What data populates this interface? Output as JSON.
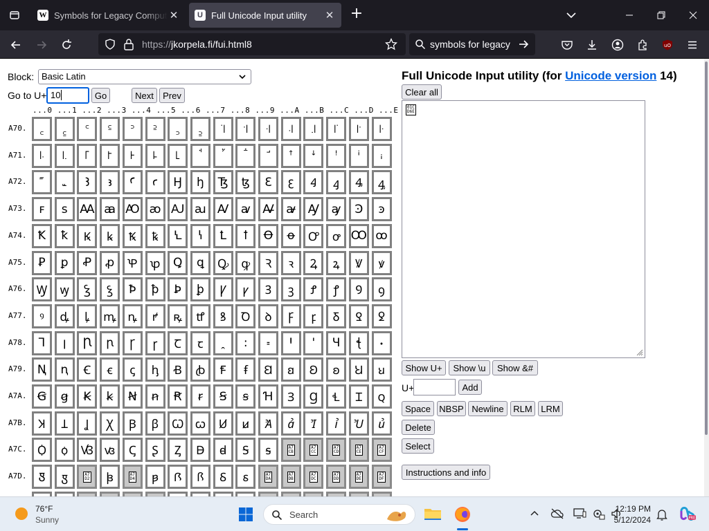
{
  "browser": {
    "tabs": [
      {
        "title": "Symbols for Legacy Computing",
        "favicon": "W",
        "active": false
      },
      {
        "title": "Full Unicode Input utility",
        "favicon": "U",
        "active": true
      }
    ],
    "url_scheme": "https://",
    "url_rest": "jkorpela.fi/fui.html8",
    "search_text": "symbols for legacy c"
  },
  "page": {
    "block_label": "Block:",
    "block_value": "Basic Latin",
    "goto_label": "Go to U+",
    "goto_value": "10",
    "go_label": "Go",
    "next_label": "Next",
    "prev_label": "Prev",
    "column_headers": "...0 ...1 ...2 ...3 ...4 ...5 ...6 ...7 ...8 ...9 ...A ...B ...C ...D ...E ...F",
    "heading_prefix": "Full Unicode Input utility (for ",
    "heading_link": "Unicode version",
    "heading_suffix": " 14)",
    "clear_all_label": "Clear all",
    "textarea_char": "01C\nD6E",
    "show_uplus_label": "Show U+",
    "show_u_label": "Show \\u",
    "show_amp_label": "Show &#",
    "uplus_label": "U+",
    "add_label": "Add",
    "space_label": "Space",
    "nbsp_label": "NBSP",
    "newline_label": "Newline",
    "rlm_label": "RLM",
    "lrm_label": "LRM",
    "delete_label": "Delete",
    "select_label": "Select",
    "instructions_label": "Instructions and info"
  },
  "grid": [
    {
      "label": "A70.",
      "cells": [
        "꜀",
        "꜁",
        "꜂",
        "꜃",
        "꜄",
        "꜅",
        "꜆",
        "꜇",
        "꜈",
        "꜉",
        "꜊",
        "꜋",
        "꜌",
        "꜍",
        "꜎",
        "꜏"
      ]
    },
    {
      "label": "A71.",
      "cells": [
        "꜐",
        "꜑",
        "꜒",
        "꜓",
        "꜔",
        "꜕",
        "꜖",
        "ꜗ",
        "ꜘ",
        "ꜙ",
        "ꜚ",
        "ꜛ",
        "ꜜ",
        "ꜝ",
        "ꜞ",
        "ꜟ"
      ]
    },
    {
      "label": "A72.",
      "cells": [
        "꜠",
        "꜡",
        "Ꜣ",
        "ꜣ",
        "Ꜥ",
        "ꜥ",
        "Ꜧ",
        "ꜧ",
        "Ꜩ",
        "ꜩ",
        "Ꜫ",
        "ꜫ",
        "Ꜭ",
        "ꜭ",
        "Ꜯ",
        "ꜯ"
      ]
    },
    {
      "label": "A73.",
      "cells": [
        "ꜰ",
        "ꜱ",
        "Ꜳ",
        "ꜳ",
        "Ꜵ",
        "ꜵ",
        "Ꜷ",
        "ꜷ",
        "Ꜹ",
        "ꜹ",
        "Ꜻ",
        "ꜻ",
        "Ꜽ",
        "ꜽ",
        "Ꜿ",
        "ꜿ"
      ]
    },
    {
      "label": "A74.",
      "cells": [
        "Ꝁ",
        "ꝁ",
        "Ꝃ",
        "ꝃ",
        "Ꝅ",
        "ꝅ",
        "Ꝇ",
        "ꝇ",
        "Ꝉ",
        "ꝉ",
        "Ꝋ",
        "ꝋ",
        "Ꝍ",
        "ꝍ",
        "Ꝏ",
        "ꝏ"
      ]
    },
    {
      "label": "A75.",
      "cells": [
        "Ꝑ",
        "ꝑ",
        "Ꝓ",
        "ꝓ",
        "Ꝕ",
        "ꝕ",
        "Ꝗ",
        "ꝗ",
        "Ꝙ",
        "ꝙ",
        "Ꝛ",
        "ꝛ",
        "Ꝝ",
        "ꝝ",
        "Ꝟ",
        "ꝟ"
      ]
    },
    {
      "label": "A76.",
      "cells": [
        "Ꝡ",
        "ꝡ",
        "Ꝣ",
        "ꝣ",
        "Ꝥ",
        "ꝥ",
        "Ꝧ",
        "ꝧ",
        "Ꝩ",
        "ꝩ",
        "Ꝫ",
        "ꝫ",
        "Ꝭ",
        "ꝭ",
        "Ꝯ",
        "ꝯ"
      ]
    },
    {
      "label": "A77.",
      "cells": [
        "ꝰ",
        "ꝱ",
        "ꝲ",
        "ꝳ",
        "ꝴ",
        "ꝵ",
        "ꝶ",
        "ꝷ",
        "ꝸ",
        "Ꝺ",
        "ꝺ",
        "Ꝼ",
        "ꝼ",
        "Ᵹ",
        "Ꝿ",
        "ꝿ"
      ]
    },
    {
      "label": "A78.",
      "cells": [
        "Ꞁ",
        "ꞁ",
        "Ꞃ",
        "ꞃ",
        "Ꞅ",
        "ꞅ",
        "Ꞇ",
        "ꞇ",
        "ꞈ",
        "꞉",
        "꞊",
        "Ꞌ",
        "ꞌ",
        "Ɥ",
        "ꞎ",
        "ꞏ"
      ]
    },
    {
      "label": "A79.",
      "cells": [
        "Ꞑ",
        "ꞑ",
        "Ꞓ",
        "ꞓ",
        "ꞔ",
        "ꞕ",
        "Ꞗ",
        "ꞗ",
        "Ꞙ",
        "ꞙ",
        "Ꞛ",
        "ꞛ",
        "Ꞝ",
        "ꞝ",
        "Ꞟ",
        "ꞟ"
      ]
    },
    {
      "label": "A7A.",
      "cells": [
        "Ꞡ",
        "ꞡ",
        "Ꞣ",
        "ꞣ",
        "Ꞥ",
        "ꞥ",
        "Ꞧ",
        "ꞧ",
        "Ꞩ",
        "ꞩ",
        "Ɦ",
        "Ɜ",
        "Ɡ",
        "Ɬ",
        "Ɪ",
        "ꞯ"
      ]
    },
    {
      "label": "A7B.",
      "cells": [
        "Ʞ",
        "Ʇ",
        "Ʝ",
        "Ꭓ",
        "Ꞵ",
        "ꞵ",
        "Ꞷ",
        "ꞷ",
        "Ꞹ",
        "ꞹ",
        "Ꞻ",
        "ꞻ",
        "Ꞽ",
        "ꞽ",
        "Ꞿ",
        "ꞿ"
      ]
    },
    {
      "label": "A7C.",
      "cells": [
        "Ꟁ",
        "ꟁ",
        "Ꟃ",
        "ꟃ",
        "Ꞔ",
        "Ʂ",
        "Ᶎ",
        "Ꟈ",
        "ꟈ",
        "Ꟊ",
        "ꟊ",
        "#A7CB",
        "#A7CC",
        "#A7CD",
        "#A7CE",
        "#A7CF"
      ]
    },
    {
      "label": "A7D.",
      "cells": [
        "Ꟑ",
        "ꟑ",
        "#A7D2",
        "ꟓ",
        "#A7D4",
        "ꟕ",
        "Ꟗ",
        "ꟗ",
        "Ꟙ",
        "ꟙ",
        "#A7DA",
        "#A7DB",
        "#A7DC",
        "#A7DD",
        "#A7DE",
        "#A7DF"
      ]
    }
  ],
  "taskbar": {
    "weather_temp": "76°F",
    "weather_desc": "Sunny",
    "search_label": "Search",
    "time": "12:19 PM",
    "date": "5/12/2024"
  }
}
